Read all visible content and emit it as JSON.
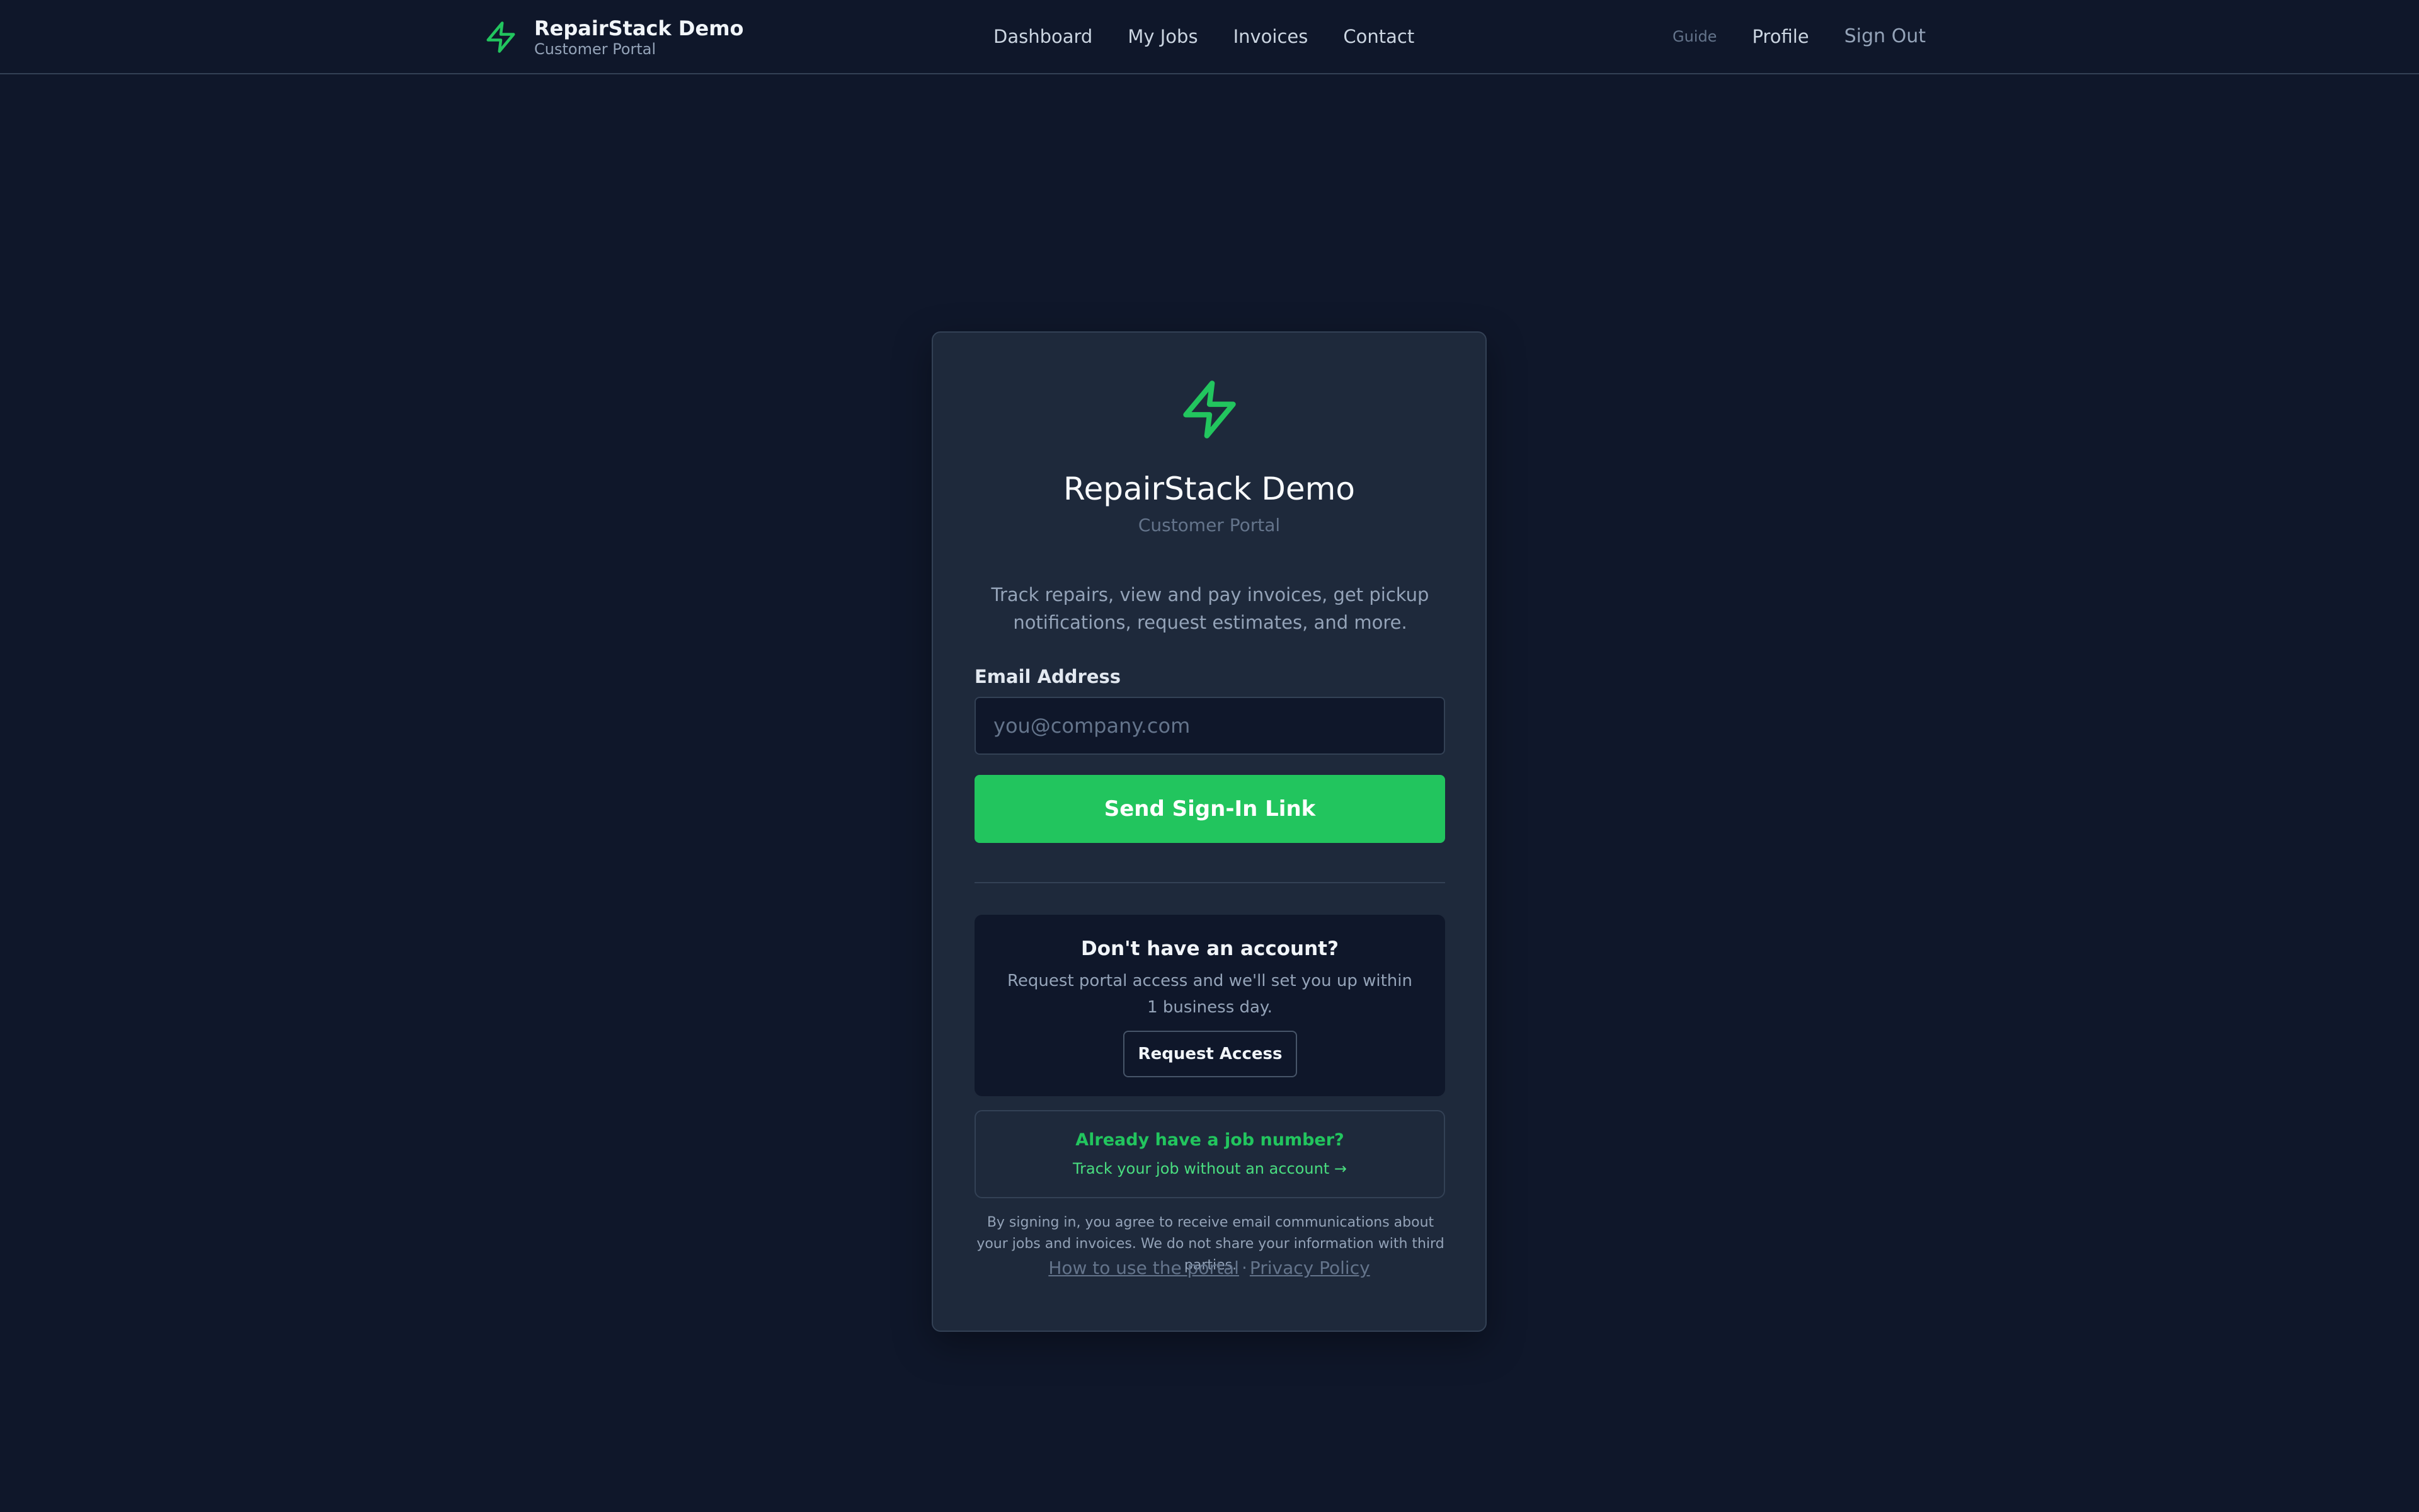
{
  "header": {
    "brand_title": "RepairStack Demo",
    "brand_subtitle": "Customer Portal",
    "nav": {
      "dashboard": "Dashboard",
      "my_jobs": "My Jobs",
      "invoices": "Invoices",
      "contact": "Contact"
    },
    "guide": "Guide",
    "profile": "Profile",
    "sign_out": "Sign Out"
  },
  "login_card": {
    "logo_icon": "lightning-bolt-icon",
    "title": "RepairStack Demo",
    "subtitle": "Customer Portal",
    "tagline": "Track repairs, view and pay invoices, get pickup notifications, request estimates, and more.",
    "email_label": "Email Address",
    "email_value": "",
    "email_placeholder": "you@company.com",
    "submit_label": "Send Sign-In Link"
  },
  "signup": {
    "heading": "Don't have an account?",
    "text": "Request portal access and we'll set you up within 1 business day.",
    "button_label": "Request Access"
  },
  "track": {
    "heading": "Already have a job number?",
    "link": "Track your job without an account →"
  },
  "legal": {
    "text": "By signing in, you agree to receive email communications about your jobs and invoices. We do not share your information with third parties.",
    "how_to_link": "How to use the portal",
    "separator": "·",
    "privacy_link": "Privacy Policy"
  },
  "colors": {
    "background": "#0f172a",
    "card": "#1e293b",
    "accent": "#22c55e",
    "border": "#334155"
  }
}
